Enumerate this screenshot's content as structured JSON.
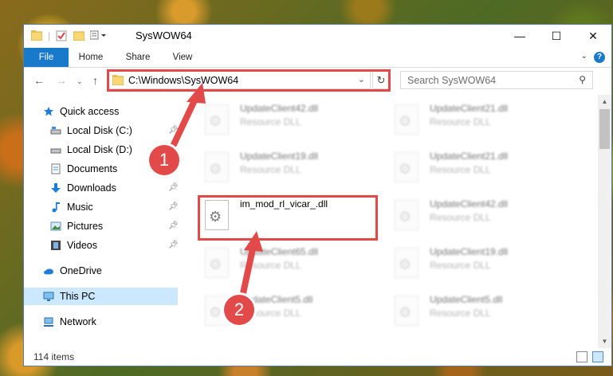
{
  "window": {
    "title": "SysWOW64",
    "controls": {
      "minimize": "—",
      "maximize": "☐",
      "close": "✕"
    }
  },
  "ribbon": {
    "tabs": [
      "File",
      "Home",
      "Share",
      "View"
    ],
    "help": "?"
  },
  "address": {
    "path": "C:\\Windows\\SysWOW64",
    "search_placeholder": "Search SysWOW64"
  },
  "sidebar": {
    "items": [
      {
        "label": "Quick access",
        "icon": "star-icon"
      },
      {
        "label": "Local Disk (C:)",
        "icon": "drive-icon",
        "pinned": true
      },
      {
        "label": "Local Disk (D:)",
        "icon": "drive-icon"
      },
      {
        "label": "Documents",
        "icon": "documents-icon"
      },
      {
        "label": "Downloads",
        "icon": "download-arrow-icon",
        "pinned": true
      },
      {
        "label": "Music",
        "icon": "music-note-icon",
        "pinned": true
      },
      {
        "label": "Pictures",
        "icon": "pictures-icon",
        "pinned": true
      },
      {
        "label": "Videos",
        "icon": "film-icon",
        "pinned": true
      },
      {
        "label": "OneDrive",
        "icon": "cloud-icon"
      },
      {
        "label": "This PC",
        "icon": "monitor-icon",
        "selected": true
      },
      {
        "label": "Network",
        "icon": "network-icon"
      }
    ]
  },
  "files": {
    "left_column": [
      {
        "name": "UpdateClient42.dll",
        "type": "Resource DLL"
      },
      {
        "name": "UpdateClient19.dll",
        "type": "Resource DLL"
      },
      {
        "name": "im_mod_rl_vicar_.dll",
        "type": ""
      },
      {
        "name": "UpdateClient65.dll",
        "type": "Resource DLL"
      },
      {
        "name": "UpdateClient5.dll",
        "type": "Resource DLL"
      }
    ],
    "right_column": [
      {
        "name": "UpdateClient21.dll",
        "type": "Resource DLL"
      },
      {
        "name": "UpdateClient21.dll",
        "type": "Resource DLL"
      },
      {
        "name": "UpdateClient42.dll",
        "type": "Resource DLL"
      },
      {
        "name": "UpdateClient19.dll",
        "type": "Resource DLL"
      },
      {
        "name": "UpdateClient5.dll",
        "type": "Resource DLL"
      }
    ]
  },
  "status": {
    "count": "114 items"
  },
  "annotations": {
    "step1": "1",
    "step2": "2"
  },
  "colors": {
    "accent": "#1979ca",
    "annotation": "#e24a4a",
    "selection": "#cce8ff"
  }
}
